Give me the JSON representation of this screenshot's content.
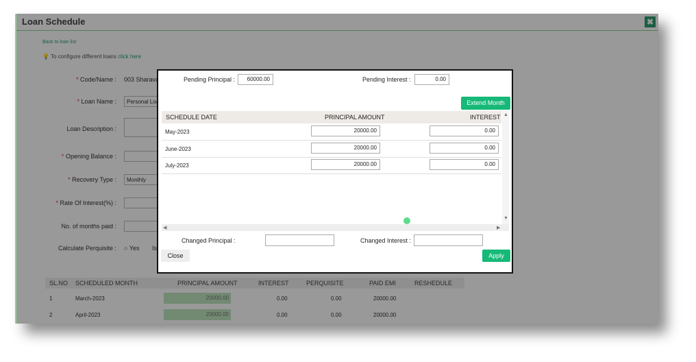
{
  "window": {
    "title": "Loan Schedule"
  },
  "nav": {
    "back_link": "Back to loan list",
    "configure_text": "To configure different loans",
    "configure_link": "click here"
  },
  "form": {
    "code_name_label": "Code/Name :",
    "code_name_value": "003 Sharavan",
    "loan_name_label": "Loan Name :",
    "loan_name_value": "Personal Loan",
    "loan_description_label": "Loan Description :",
    "opening_balance_label": "Opening Balance :",
    "recovery_type_label": "Recovery Type :",
    "recovery_type_value": "Monthly",
    "rate_of_interest_label": "Rate Of Interest(%) :",
    "months_paid_label": "No. of months paid :",
    "calc_perquisite_label": "Calculate Perquisite :",
    "yes_label": "Yes",
    "is_label": "Is"
  },
  "bg_table": {
    "headers": [
      "SL.NO",
      "SCHEDULED MONTH",
      "PRINCIPAL AMOUNT",
      "INTEREST",
      "PERQUISITE",
      "PAID EMI",
      "RESHEDULE"
    ],
    "rows": [
      {
        "sl": "1",
        "month": "March-2023",
        "principal": "20000.00",
        "interest": "0.00",
        "perquisite": "0.00",
        "paid_emi": "20000.00"
      },
      {
        "sl": "2",
        "month": "April-2023",
        "principal": "20000.00",
        "interest": "0.00",
        "perquisite": "0.00",
        "paid_emi": "20000.00"
      }
    ]
  },
  "modal": {
    "pending_principal_label": "Pending Principal :",
    "pending_principal_value": "60000.00",
    "pending_interest_label": "Pending Interest :",
    "pending_interest_value": "0.00",
    "extend_month_label": "Extend Month",
    "headers": [
      "SCHEDULE DATE",
      "PRINCIPAL AMOUNT",
      "INTEREST"
    ],
    "rows": [
      {
        "date": "May-2023",
        "principal": "20000.00",
        "interest": "0.00"
      },
      {
        "date": "June-2023",
        "principal": "20000.00",
        "interest": "0.00"
      },
      {
        "date": "July-2023",
        "principal": "20000.00",
        "interest": "0.00"
      }
    ],
    "changed_principal_label": "Changed Principal :",
    "changed_principal_value": "",
    "changed_interest_label": "Changed Interest :",
    "changed_interest_value": "",
    "close_label": "Close",
    "apply_label": "Apply"
  },
  "colors": {
    "accent": "#17b978",
    "title_border": "#8fd08f",
    "header_bg": "#eeeae6"
  },
  "icons": {
    "close": "close-icon",
    "bulb": "lightbulb-icon"
  }
}
